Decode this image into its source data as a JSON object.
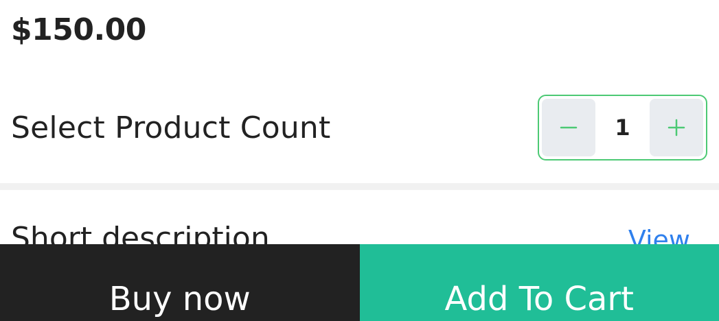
{
  "product": {
    "price": "$150.00"
  },
  "quantity": {
    "label": "Select Product Count",
    "value": "1",
    "decrement_icon": "minus-icon",
    "increment_icon": "plus-icon"
  },
  "description": {
    "title": "Short description",
    "view_label": "View"
  },
  "actions": {
    "buy_now_label": "Buy now",
    "add_to_cart_label": "Add To Cart"
  },
  "colors": {
    "accent_green": "#4cc974",
    "cart_button": "#20be97",
    "buy_button": "#222222",
    "link_blue": "#2f80ed",
    "stepper_button_bg": "#e9ecf0"
  }
}
